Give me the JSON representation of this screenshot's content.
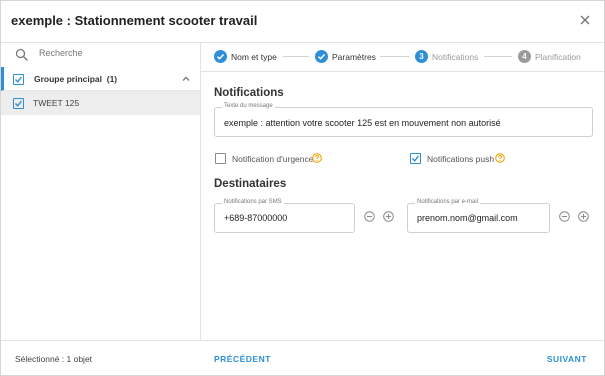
{
  "dialog": {
    "title": "exemple : Stationnement scooter travail"
  },
  "sidebar": {
    "search_placeholder": "Recherche",
    "group": {
      "label": "Groupe principal",
      "count": "(1)"
    },
    "items": [
      {
        "label": "TWEET 125"
      }
    ]
  },
  "steps": [
    {
      "label": "Nom et type",
      "state": "done"
    },
    {
      "label": "Paramètres",
      "state": "done"
    },
    {
      "number": "3",
      "label": "Notifications",
      "state": "current"
    },
    {
      "number": "4",
      "label": "Planification",
      "state": "pending"
    }
  ],
  "notifications": {
    "heading": "Notifications",
    "message_label": "Texte du message",
    "message_value": "exemple : attention votre scooter 125 est en mouvement non autorisé",
    "urgent_label": "Notification d'urgence",
    "push_label": "Notifications push"
  },
  "recipients": {
    "heading": "Destinataires",
    "sms_label": "Notifications par SMS",
    "sms_value": "+689-87000000",
    "email_label": "Notifications par e-mail",
    "email_value": "prenom.nom@gmail.com"
  },
  "footer": {
    "selected": "Sélectionné : 1 objet",
    "prev": "PRÉCÉDENT",
    "next": "SUIVANT"
  },
  "colors": {
    "accent": "#2f8fd6",
    "help": "#f0a500",
    "pending": "#9a9a9a"
  }
}
